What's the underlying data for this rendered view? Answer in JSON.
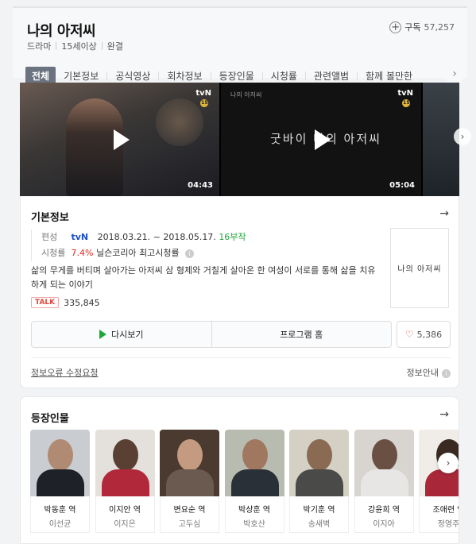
{
  "header": {
    "title": "나의 아저씨",
    "subscribe_label": "구독",
    "subscribe_count": "57,257",
    "meta": [
      "드라마",
      "15세이상",
      "완결"
    ],
    "tabs": [
      "전체",
      "기본정보",
      "공식영상",
      "회차정보",
      "등장인물",
      "시청률",
      "관련앨범",
      "함께 볼만한"
    ]
  },
  "videos": [
    {
      "channel": "tvN",
      "duration": "04:43"
    },
    {
      "channel": "tvN",
      "duration": "05:04",
      "caption": "굿바이 나의 아저씨",
      "small_caption": "나의 아저씨"
    }
  ],
  "info": {
    "title": "기본정보",
    "broadcast_label": "편성",
    "channel": "tvN",
    "dates": "2018.03.21. ~ 2018.05.17.",
    "episodes": "16부작",
    "rating_label": "시청률",
    "rating_value": "7.4%",
    "rating_source": "닐슨코리아",
    "rating_note": "최고시청률",
    "description": "삶의 무게를 버티며 살아가는 아저씨 삼 형제와 거칠게 살아온 한 여성이 서로를 통해 삶을 치유하게 되는 이야기",
    "talk_badge": "TALK",
    "talk_count": "335,845",
    "poster_text": "나의 아저씨",
    "rewatch_label": "다시보기",
    "program_home_label": "프로그램 홈",
    "like_count": "5,386",
    "error_report": "정보오류 수정요청",
    "info_guide": "정보안내"
  },
  "cast": {
    "title": "등장인물",
    "members": [
      {
        "role": "박동훈 역",
        "actor": "이선균"
      },
      {
        "role": "이지안 역",
        "actor": "이지은"
      },
      {
        "role": "변요순 역",
        "actor": "고두심"
      },
      {
        "role": "박상훈 역",
        "actor": "박호산"
      },
      {
        "role": "박기훈 역",
        "actor": "송새벽"
      },
      {
        "role": "강윤희 역",
        "actor": "이지아"
      },
      {
        "role": "조애련 역",
        "actor": "정영주"
      }
    ]
  },
  "colors": {
    "accent_green": "#1ea73c",
    "rating_red": "#e1281e",
    "tab_active_bg": "#6b7280"
  }
}
